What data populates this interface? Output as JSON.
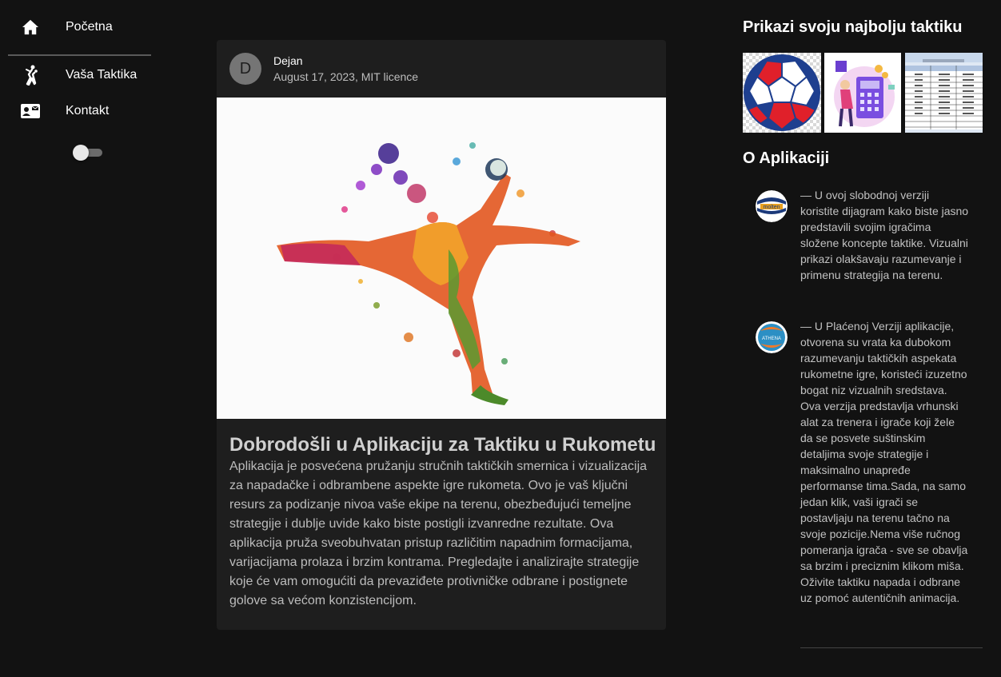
{
  "sidebar": {
    "items": [
      {
        "label": "Početna",
        "icon": "home-icon"
      },
      {
        "label": "Vaša Taktika",
        "icon": "handball-player-icon"
      },
      {
        "label": "Kontakt",
        "icon": "contact-card-icon"
      }
    ],
    "theme_icon": "moon-icon",
    "dark_mode_on": false
  },
  "post": {
    "avatar_letter": "D",
    "author": "Dejan",
    "subheader": "August 17, 2023, MIT licence",
    "title": "Dobrodošli u Aplikaciju za Taktiku u Rukometu",
    "body": "Aplikacija je posvećena pružanju stručnih taktičkih smernica i vizualizacija za napadačke i odbrambene aspekte igre rukometa. Ovo je vaš ključni resurs za podizanje nivoa vaše ekipe na terenu, obezbeđujući temeljne strategije i dublje uvide kako biste postigli izvanredne rezultate. Ova aplikacija pruža sveobuhvatan pristup različitim napadnim formacijama, varijacijama prolaza i brzim kontrama. Pregledajte i analizirajte strategije koje će vam omogućiti da prevaziđete protivničke odbrane i postignete golove sa većom konzistencijom."
  },
  "right": {
    "showcase_title": "Prikazi svoju najbolju taktiku",
    "thumbnails": [
      "handball-ball-thumbnail",
      "calculator-illustration-thumbnail",
      "spreadsheet-table-thumbnail"
    ],
    "about_title": "O Aplikaciji",
    "about_items": [
      {
        "text": "— U ovoj slobodnoj verziji koristite dijagram kako biste jasno predstavili svojim igračima složene koncepte taktike. Vizualni prikazi olakšavaju razumevanje i primenu strategija na terenu.",
        "avatar_label": "molten"
      },
      {
        "text": "— U Plaćenoj Verziji aplikacije, otvorena su vrata ka dubokom razumevanju taktičkih aspekata rukometne igre, koristeći izuzetno bogat niz vizualnih sredstava. Ova verzija predstavlja vrhunski alat za trenera i igrače koji žele da se posvete suštinskim detaljima svoje strategije i maksimalno unapređe performanse tima.Sada, na samo jedan klik, vaši igrači se postavljaju na terenu tačno na svoje pozicije.Nema više ručnog pomeranja igrača - sve se obavlja sa brzim i preciznim klikom miša. Oživite taktiku napada i odbrane uz pomoć autentičnih animacija.",
        "avatar_label": "ATHENA"
      }
    ]
  },
  "colors": {
    "background": "#121212",
    "card": "#1e1e1e",
    "ball_red": "#e0202a",
    "ball_blue": "#1e3f8f"
  }
}
